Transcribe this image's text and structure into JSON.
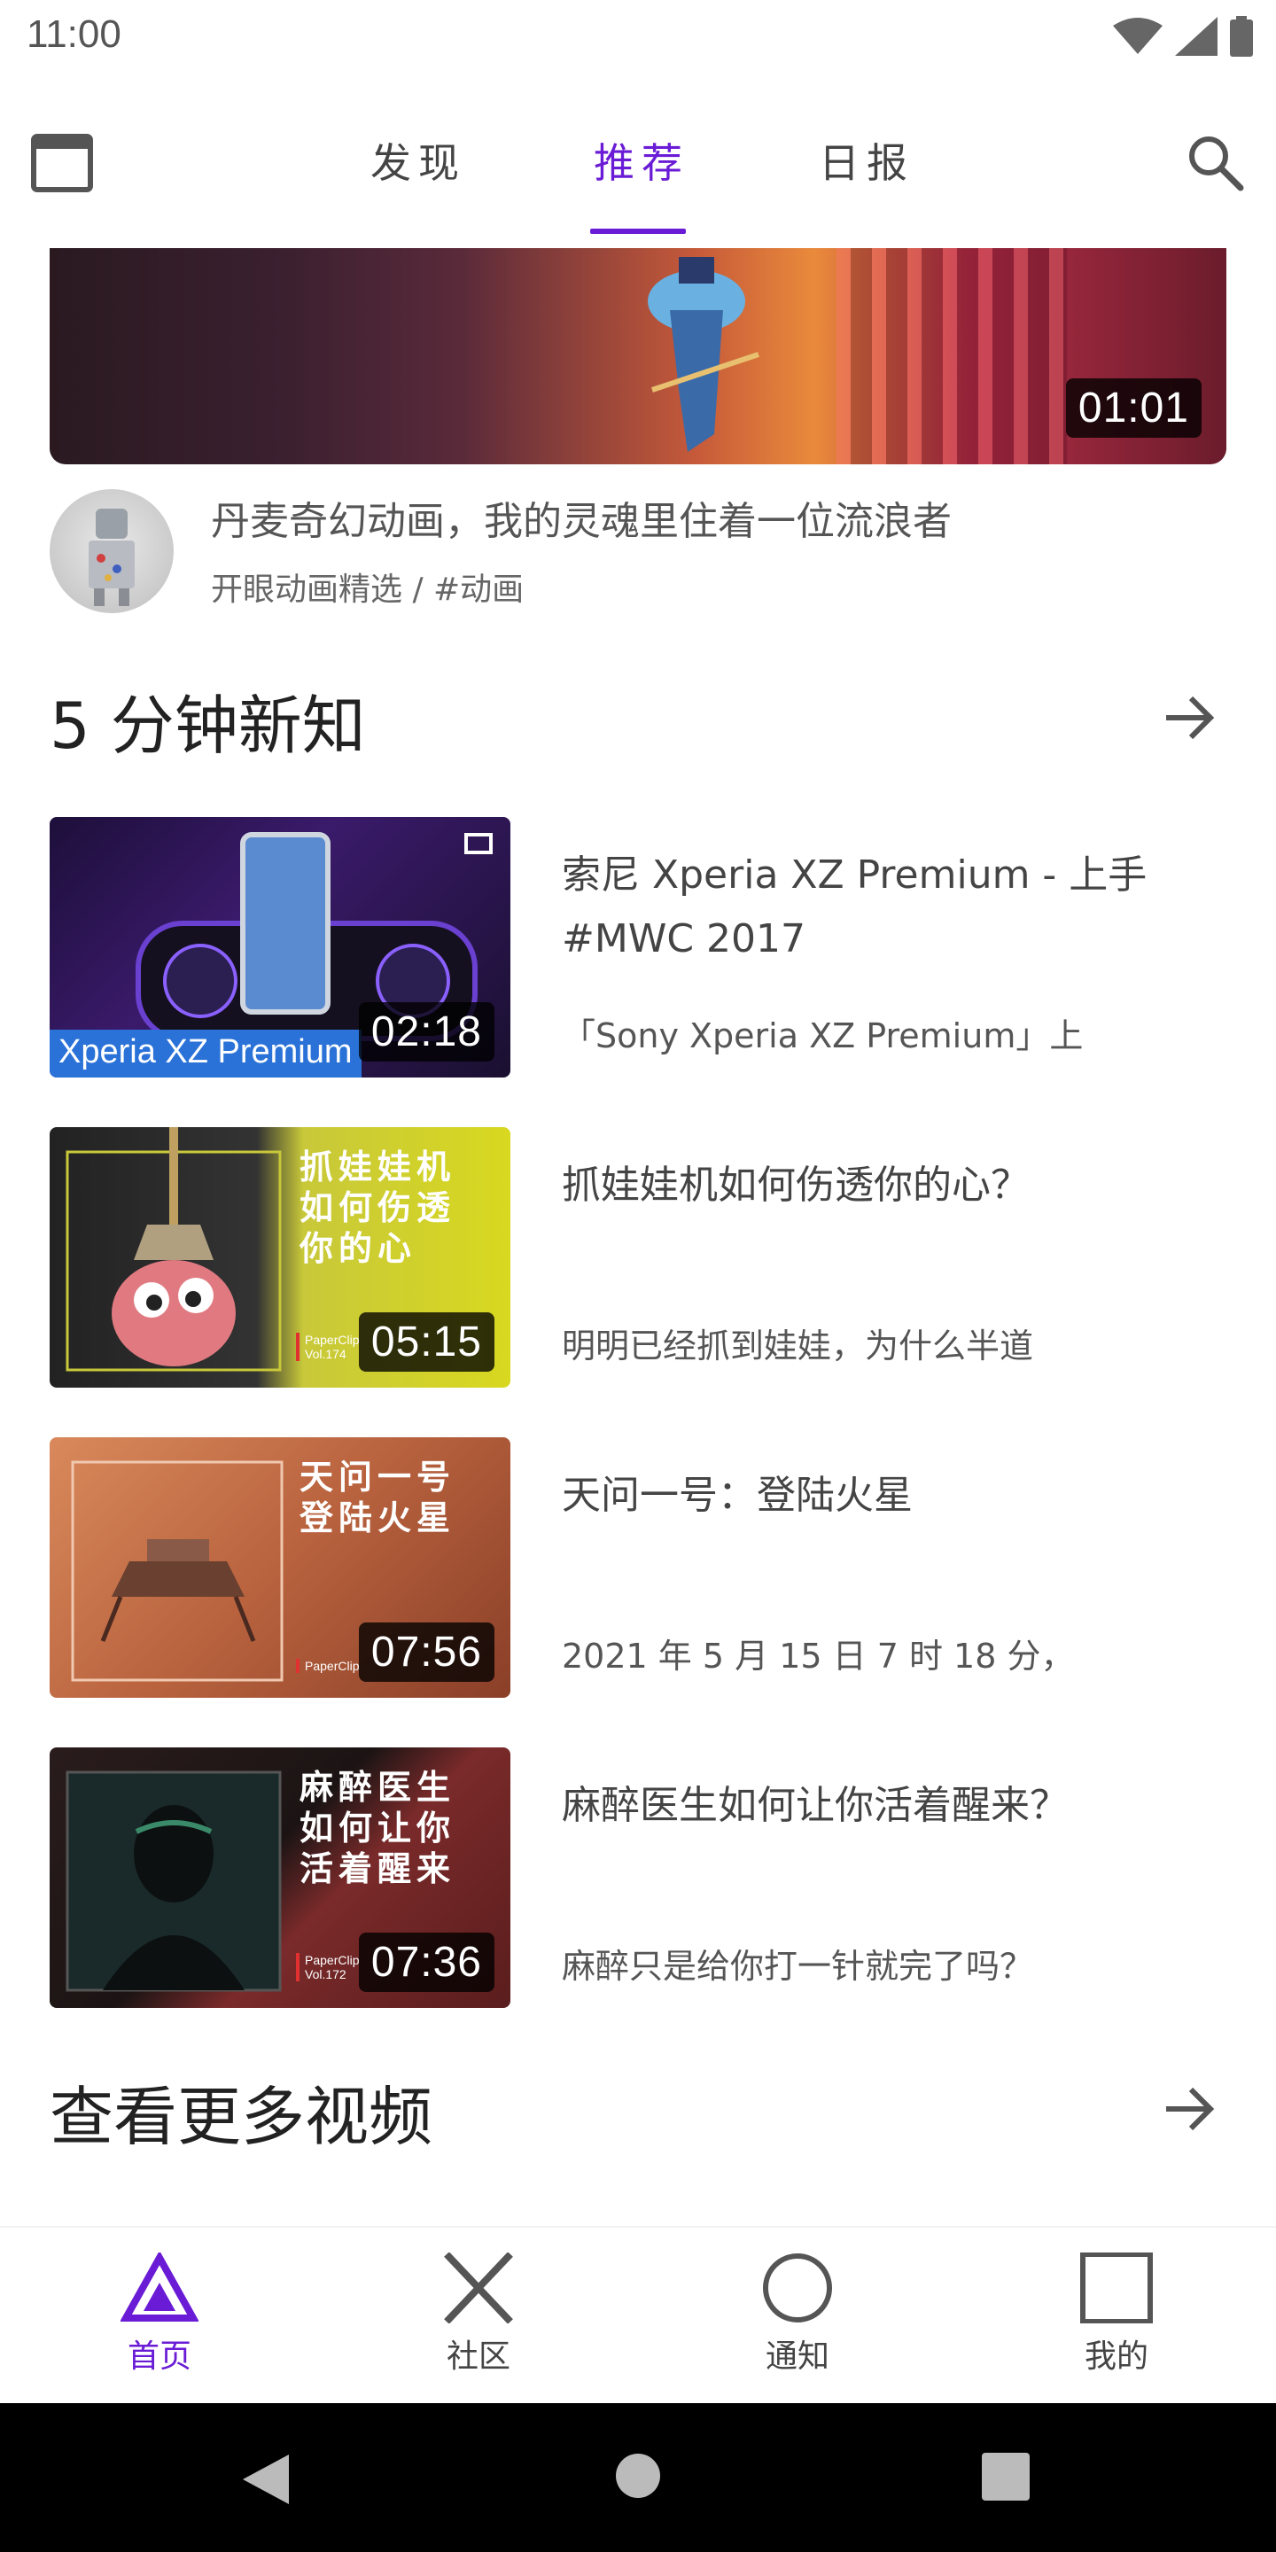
{
  "status_bar": {
    "time": "11:00"
  },
  "tabs": [
    {
      "label": "发现",
      "active": false
    },
    {
      "label": "推荐",
      "active": true
    },
    {
      "label": "日报",
      "active": false
    }
  ],
  "banner": {
    "duration": "01:01"
  },
  "featured": {
    "title": "丹麦奇幻动画，我的灵魂里住着一位流浪者",
    "subtitle": "开眼动画精选 / #动画"
  },
  "section_new": {
    "title": "5 分钟新知"
  },
  "videos": [
    {
      "title": "索尼 Xperia XZ Premium - 上手 #MWC 2017",
      "desc": "「Sony Xperia XZ Premium」上",
      "duration": "02:18",
      "brand": "Xperia XZ Premium"
    },
    {
      "title": "抓娃娃机如何伤透你的心？",
      "desc": "明明已经抓到娃娃，为什么半道",
      "duration": "05:15",
      "overlay": "抓娃娃机\n如何伤透\n你的心",
      "paper": "PaperClip\nVol.174"
    },
    {
      "title": "天问一号：登陆火星",
      "desc": "2021 年 5 月 15 日 7 时 18 分，",
      "duration": "07:56",
      "overlay": "天问一号\n登陆火星",
      "paper": "PaperClip"
    },
    {
      "title": "麻醉医生如何让你活着醒来？",
      "desc": "麻醉只是给你打一针就完了吗？",
      "duration": "07:36",
      "overlay": "麻醉医生\n如何让你\n活着醒来",
      "paper": "PaperClip\nVol.172"
    }
  ],
  "section_more": {
    "title": "查看更多视频"
  },
  "bottom_nav": [
    {
      "label": "首页",
      "icon": "triangle-icon",
      "active": true
    },
    {
      "label": "社区",
      "icon": "cross-icon",
      "active": false
    },
    {
      "label": "通知",
      "icon": "circle-icon",
      "active": false
    },
    {
      "label": "我的",
      "icon": "square-icon",
      "active": false
    }
  ],
  "colors": {
    "accent": "#6a1bd6",
    "text": "#444444"
  }
}
